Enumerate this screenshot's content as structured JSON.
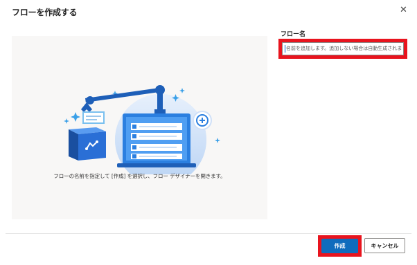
{
  "dialog": {
    "title": "フローを作成する",
    "close_label": "✕"
  },
  "illustration": {
    "caption": "フローの名前を指定して [作成] を選択し、フロー デザイナーを開きます。"
  },
  "form": {
    "flow_name_label": "フロー名",
    "flow_name_placeholder": "名前を追加します。追加しない場合は自動生成されま"
  },
  "footer": {
    "create_label": "作成",
    "cancel_label": "キャンセル"
  },
  "colors": {
    "accent": "#0f6cbd",
    "highlight": "#e8141e",
    "panel_bg": "#f8f7f6"
  }
}
